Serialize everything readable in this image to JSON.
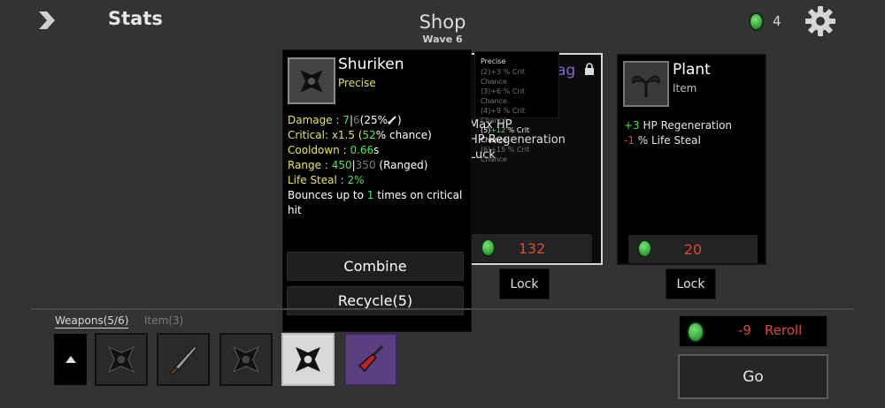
{
  "header": {
    "stats_label": "Stats",
    "title": "Shop",
    "wave": "Wave 6",
    "coins": "4"
  },
  "popover": {
    "name": "Shuriken",
    "tier": "Precise",
    "damage_label": "Damage : ",
    "damage_value": "7",
    "damage_sep": "|",
    "damage_base": "6",
    "damage_pct": "(25%",
    "critical_label": "Critical: x1.5 (",
    "critical_value": "52",
    "critical_suffix": "% chance)",
    "cooldown_label": "Cooldown : ",
    "cooldown_value": "0.66",
    "cooldown_unit": "s",
    "range_label": "Range : ",
    "range_value": "450",
    "range_sep": "|",
    "range_base": "350",
    "range_suffix": " (Ranged)",
    "lifesteal_label": "Life Steal : ",
    "lifesteal_value": "2%",
    "bounce_prefix": "Bounces up to ",
    "bounce_value": "1",
    "bounce_suffix": " times on critical hit",
    "combine_label": "Combine",
    "recycle_label": "Recycle(5)"
  },
  "tooltip": {
    "title": "Precise",
    "rows": [
      {
        "tier": "(2)",
        "num": "+3",
        "text": " % Crit Chance"
      },
      {
        "tier": "(3)",
        "num": "+6",
        "text": " % Crit Chance"
      },
      {
        "tier": "(4)",
        "num": "+9",
        "text": " % Crit Chance"
      },
      {
        "tier": "(5)",
        "num": "+12",
        "text": " % Crit Chance"
      },
      {
        "tier": "(6)",
        "num": "+15",
        "text": " % Crit Chance"
      }
    ]
  },
  "cards": [
    {
      "title_fragment": "ag",
      "lines": [
        "Max HP",
        "HP Regeneration",
        "Luck"
      ],
      "price": "132",
      "lock_label": "Lock"
    },
    {
      "name": "Plant",
      "type": "Item",
      "stat1_value": "+3",
      "stat1_text": " HP Regeneration",
      "stat2_value": "-1",
      "stat2_text": " % Life Steal",
      "price": "20",
      "lock_label": "Lock"
    }
  ],
  "inventory": {
    "weapons_tab": "Weapons(5/6)",
    "items_tab": "Item(3)",
    "slots": [
      "shuriken-icon",
      "knife-icon",
      "shuriken-icon",
      "shuriken-icon",
      "screwdriver-icon"
    ]
  },
  "actions": {
    "reroll_cost": "-9",
    "reroll_label": "Reroll",
    "go_label": "Go"
  },
  "colors": {
    "background": "#333333",
    "price_red": "#d74a3a",
    "stat_green": "#55e35a",
    "stat_yellow": "#e8e46a",
    "legendary_purple": "#5b3f82"
  }
}
